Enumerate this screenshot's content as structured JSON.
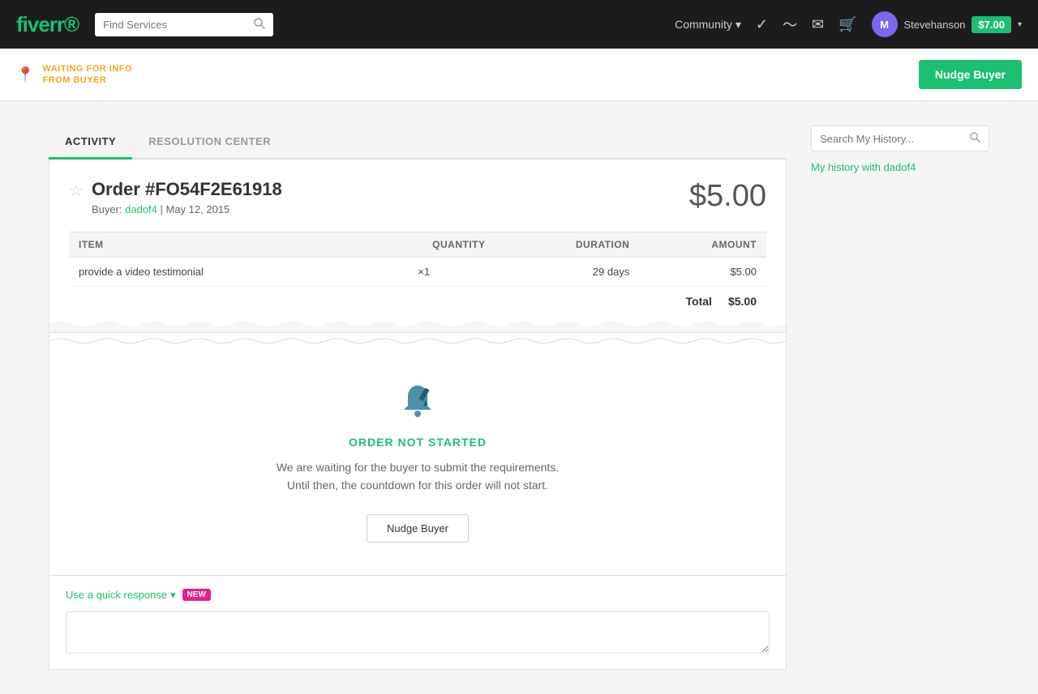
{
  "header": {
    "logo": "fiverr",
    "logo_dot": ".",
    "search_placeholder": "Find Services",
    "community_label": "Community",
    "username": "Stevehanson",
    "avatar_initial": "M",
    "balance": "$7.00"
  },
  "status_bar": {
    "label_line1": "WAITING FOR INFO",
    "label_line2": "FROM BUYER",
    "nudge_button": "Nudge Buyer"
  },
  "tabs": [
    {
      "id": "activity",
      "label": "ACTIVITY",
      "active": true
    },
    {
      "id": "resolution",
      "label": "RESOLUTION CENTER",
      "active": false
    }
  ],
  "order": {
    "title": "Order #FO54F2E61918",
    "buyer_prefix": "Buyer: ",
    "buyer_name": "dadof4",
    "date_separator": " | ",
    "date": "May 12, 2015",
    "amount": "$5.00",
    "table": {
      "headers": [
        "ITEM",
        "QUANTITY",
        "DURATION",
        "AMOUNT"
      ],
      "rows": [
        {
          "item": "provide a video testimonial",
          "quantity": "×1",
          "duration": "29 days",
          "amount": "$5.00"
        }
      ],
      "total_label": "Total",
      "total_value": "$5.00"
    }
  },
  "not_started": {
    "title": "ORDER NOT STARTED",
    "line1": "We are waiting for the buyer to submit the requirements.",
    "line2": "Until then, the countdown for this order will not start.",
    "nudge_button": "Nudge Buyer"
  },
  "quick_response": {
    "link_text": "Use a quick response",
    "new_label": "NEW",
    "textarea_placeholder": ""
  },
  "sidebar": {
    "search_placeholder": "Search My History...",
    "history_link": "My history with dadof4"
  }
}
